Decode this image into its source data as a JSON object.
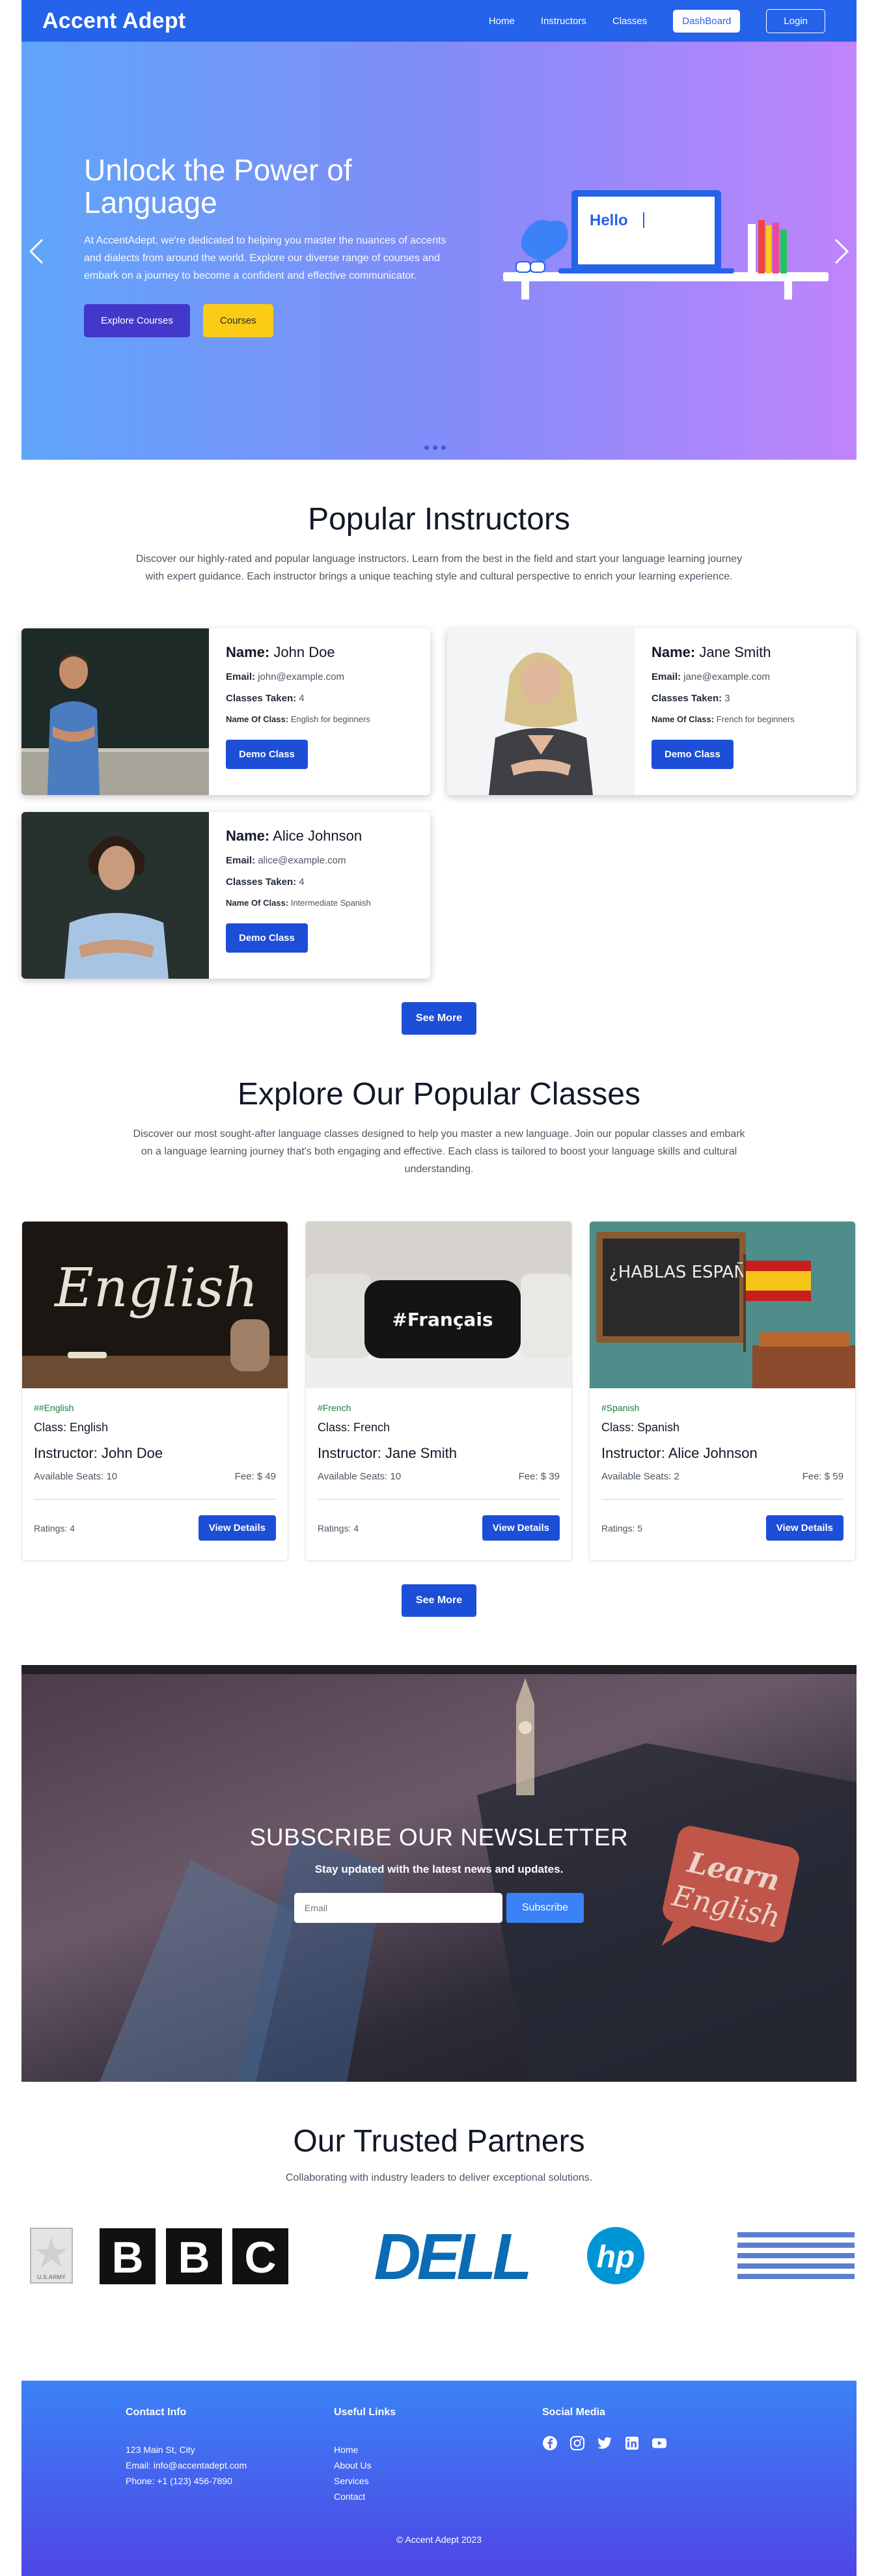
{
  "nav": {
    "brand": "Accent Adept",
    "links": [
      "Home",
      "Instructors",
      "Classes"
    ],
    "dashboard": "DashBoard",
    "login": "Login"
  },
  "hero": {
    "title": "Unlock the Power of Language",
    "description": "At AccentAdept, we're dedicated to helping you master the nuances of accents and dialects from around the world. Explore our diverse range of courses and embark on a journey to become a confident and effective communicator.",
    "explore_label": "Explore Courses",
    "courses_label": "Courses",
    "illustration_text": "Hello",
    "prev_icon": "chevron-left-icon",
    "next_icon": "chevron-right-icon"
  },
  "instructors": {
    "title": "Popular Instructors",
    "description": "Discover our highly-rated and popular language instructors. Learn from the best in the field and start your language learning journey with expert guidance. Each instructor brings a unique teaching style and cultural perspective to enrich your learning experience.",
    "labels": {
      "name": "Name:",
      "email": "Email:",
      "classes_taken": "Classes Taken:",
      "class_name": "Name Of Class:",
      "demo": "Demo Class"
    },
    "items": [
      {
        "name": "John Doe",
        "email": "john@example.com",
        "classes_taken": "4",
        "class_name": "English for beginners"
      },
      {
        "name": "Jane Smith",
        "email": "jane@example.com",
        "classes_taken": "3",
        "class_name": "French for beginners"
      },
      {
        "name": "Alice Johnson",
        "email": "alice@example.com",
        "classes_taken": "4",
        "class_name": "Intermediate Spanish"
      }
    ],
    "see_more": "See More"
  },
  "classes": {
    "title": "Explore Our Popular Classes",
    "description": "Discover our most sought-after language classes designed to help you master a new language. Join our popular classes and embark on a language learning journey that's both engaging and effective. Each class is tailored to boost your language skills and cultural understanding.",
    "items": [
      {
        "image_text": "English",
        "tag": "##English",
        "class": "Class: English",
        "instructor": "Instructor: John Doe",
        "seats": "Available Seats: 10",
        "fee": "Fee: $ 49",
        "ratings": "Ratings: 4",
        "details": "View Details"
      },
      {
        "image_text": "#Français",
        "tag": "#French",
        "class": "Class: French",
        "instructor": "Instructor: Jane Smith",
        "seats": "Available Seats: 10",
        "fee": "Fee: $ 39",
        "ratings": "Ratings: 4",
        "details": "View Details"
      },
      {
        "image_text": "¿HABLAS ESPAÑOL?",
        "tag": "#Spanish",
        "class": "Class: Spanish",
        "instructor": "Instructor: Alice Johnson",
        "seats": "Available Seats: 2",
        "fee": "Fee: $ 59",
        "ratings": "Ratings: 5",
        "details": "View Details"
      }
    ],
    "see_more": "See More"
  },
  "newsletter": {
    "title": "SUBSCRIBE OUR NEWSLETTER",
    "subtitle": "Stay updated with the latest news and updates.",
    "placeholder": "Email",
    "button": "Subscribe",
    "image_text_1": "Learn",
    "image_text_2": "English"
  },
  "partners": {
    "title": "Our Trusted Partners",
    "subtitle": "Collaborating with industry leaders to deliver exceptional solutions.",
    "logos": [
      "U.S.ARMY",
      "BBC",
      "DELL",
      "hp",
      "IBM"
    ]
  },
  "footer": {
    "contact_title": "Contact Info",
    "contact": [
      "123 Main St, City",
      "Email: info@accentadept.com",
      "Phone: +1 (123) 456-7890"
    ],
    "links_title": "Useful Links",
    "links": [
      "Home",
      "About Us",
      "Services",
      "Contact"
    ],
    "social_title": "Social Media",
    "social_icons": [
      "facebook-icon",
      "instagram-icon",
      "twitter-icon",
      "linkedin-icon",
      "youtube-icon"
    ],
    "copyright": "© Accent Adept 2023"
  },
  "colors": {
    "primary": "#2563eb",
    "indigo": "#4338ca",
    "yellow": "#facc15",
    "tag_green": "#15803d"
  }
}
